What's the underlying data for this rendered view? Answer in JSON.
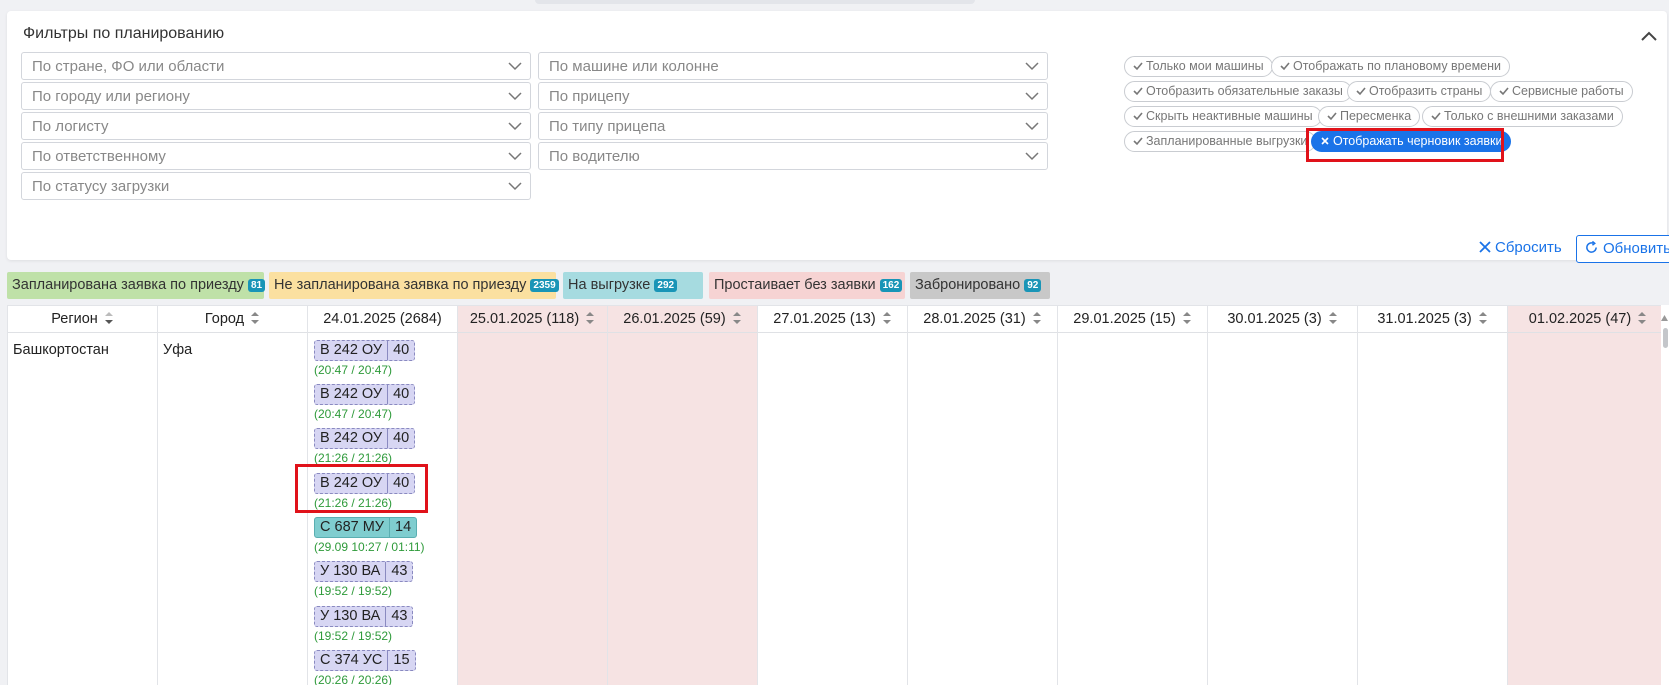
{
  "panel": {
    "title": "Фильтры по планированию",
    "selects": [
      {
        "placeholder": "По стране, ФО или области"
      },
      {
        "placeholder": "По городу или региону"
      },
      {
        "placeholder": "По логисту"
      },
      {
        "placeholder": "По ответственному"
      },
      {
        "placeholder": "По статусу загрузки"
      },
      {
        "placeholder": "По машине или колонне"
      },
      {
        "placeholder": "По прицепу"
      },
      {
        "placeholder": "По типу прицепа"
      },
      {
        "placeholder": "По водителю"
      }
    ],
    "chips": [
      {
        "label": "Только мои машины",
        "active": false
      },
      {
        "label": "Отображать по плановому времени",
        "active": false
      },
      {
        "label": "Отобразить обязательные заказы",
        "active": false
      },
      {
        "label": "Отобразить страны",
        "active": false
      },
      {
        "label": "Сервисные работы",
        "active": false
      },
      {
        "label": "Скрыть неактивные машины",
        "active": false
      },
      {
        "label": "Пересменка",
        "active": false
      },
      {
        "label": "Только с внешними заказами",
        "active": false
      },
      {
        "label": "Запланированные выгрузки",
        "active": false
      },
      {
        "label": "Отображать черновик заявки",
        "active": true
      }
    ],
    "reset_label": "Сбросить",
    "refresh_label": "Обновить"
  },
  "legend": [
    {
      "label": "Запланирована заявка по приезду",
      "count": "81",
      "color": "#bfe1a8"
    },
    {
      "label": "Не запланирована заявка по приезду",
      "count": "2359",
      "color": "#fbe0a0"
    },
    {
      "label": "На выгрузке",
      "count": "292",
      "color": "#a6dbe0"
    },
    {
      "label": "Простаивает без заявки",
      "count": "162",
      "color": "#f6d3d3"
    },
    {
      "label": "Забронировано",
      "count": "92",
      "color": "#c8c8c8"
    }
  ],
  "table": {
    "columns": [
      "Регион",
      "Город",
      "24.01.2025 (2684)",
      "25.01.2025 (118)",
      "26.01.2025 (59)",
      "27.01.2025 (13)",
      "28.01.2025 (31)",
      "29.01.2025 (15)",
      "30.01.2025 (3)",
      "31.01.2025 (3)",
      "01.02.2025 (47)"
    ],
    "row": {
      "region": "Башкортостан",
      "city": "Уфа",
      "trucks": [
        {
          "plate": "В 242 ОУ",
          "count": "40",
          "time": "(20:47 / 20:47)",
          "style": "draft"
        },
        {
          "plate": "В 242 ОУ",
          "count": "40",
          "time": "(20:47 / 20:47)",
          "style": "draft"
        },
        {
          "plate": "В 242 ОУ",
          "count": "40",
          "time": "(21:26 / 21:26)",
          "style": "draft"
        },
        {
          "plate": "В 242 ОУ",
          "count": "40",
          "time": "(21:26 / 21:26)",
          "style": "draft"
        },
        {
          "plate": "С 687 МУ",
          "count": "14",
          "time": "(29.09 10:27 / 01:11)",
          "style": "unloading"
        },
        {
          "plate": "У 130 ВА",
          "count": "43",
          "time": "(19:52 / 19:52)",
          "style": "draft"
        },
        {
          "plate": "У 130 ВА",
          "count": "43",
          "time": "(19:52 / 19:52)",
          "style": "draft"
        },
        {
          "plate": "С 374 УС",
          "count": "15",
          "time": "(20:26 / 20:26)",
          "style": "draft"
        }
      ]
    }
  },
  "colors": {
    "accent": "#1a73e8",
    "highlight": "#e0121a",
    "weekend": "#f6e3e3",
    "time": "#2e9a3a"
  }
}
